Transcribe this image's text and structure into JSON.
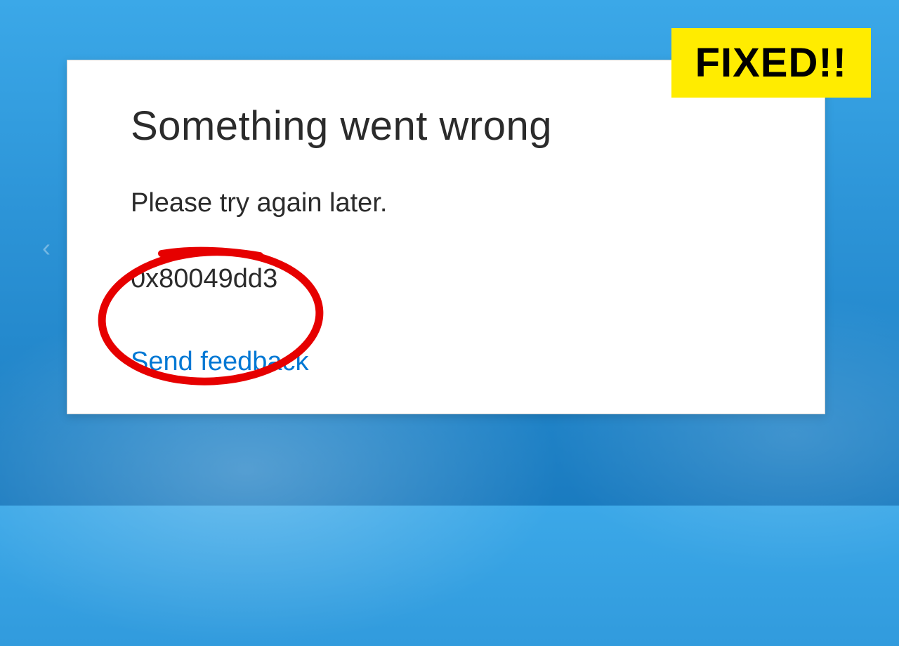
{
  "dialog": {
    "title": "Something went wrong",
    "message": "Please try again later.",
    "error_code": "0x80049dd3",
    "feedback_link": "Send feedback"
  },
  "nav": {
    "prev_arrow": "‹"
  },
  "badge": {
    "text": "FIXED!!"
  },
  "colors": {
    "highlight": "#e60000",
    "badge_bg": "#ffec00",
    "link": "#0078d4"
  }
}
